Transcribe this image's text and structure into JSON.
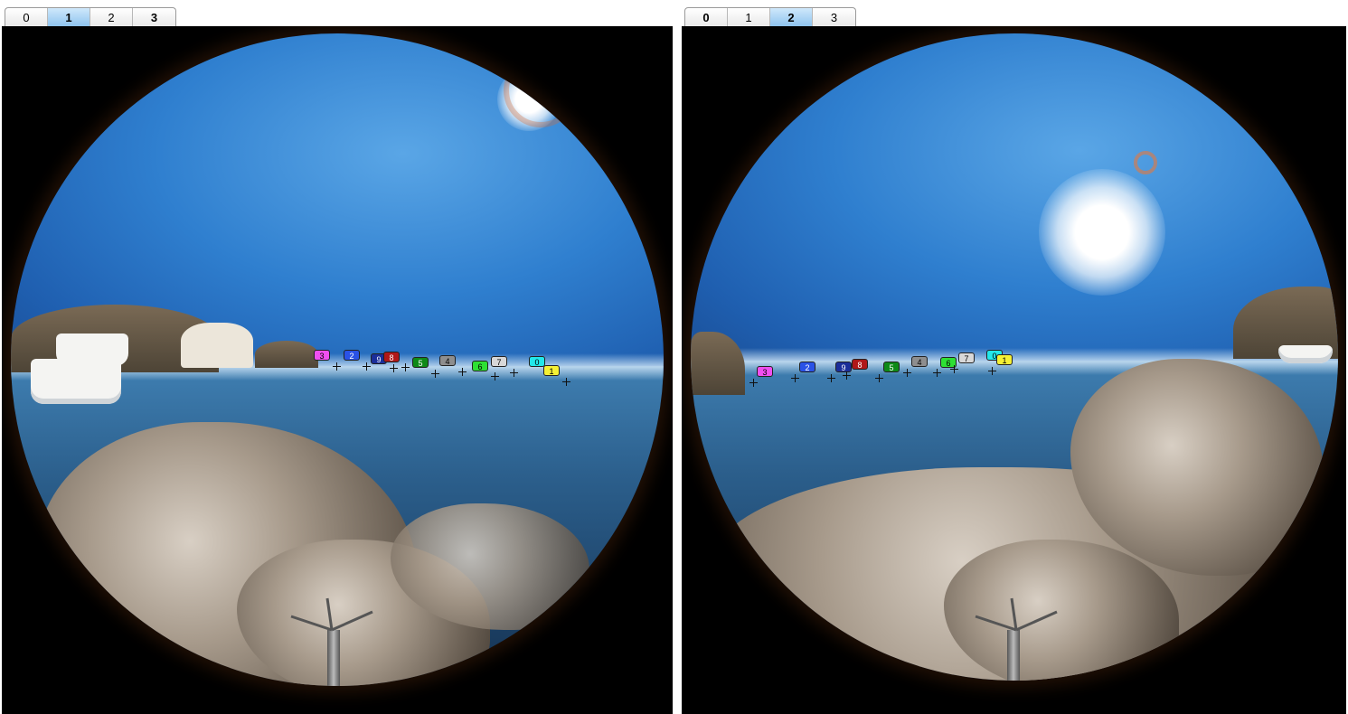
{
  "left_panel": {
    "tabs": [
      {
        "label": "0",
        "active": false,
        "bold": false
      },
      {
        "label": "1",
        "active": true,
        "bold": true
      },
      {
        "label": "2",
        "active": false,
        "bold": false
      },
      {
        "label": "3",
        "active": false,
        "bold": true
      }
    ],
    "markers": [
      {
        "label": "3",
        "color": "#f04ff0",
        "text_color": "#000000"
      },
      {
        "label": "2",
        "color": "#2a52e6",
        "text_color": "#ffffff"
      },
      {
        "label": "9",
        "color": "#1b2e9a",
        "text_color": "#ffffff"
      },
      {
        "label": "8",
        "color": "#b01818",
        "text_color": "#ffffff"
      },
      {
        "label": "5",
        "color": "#0e8a18",
        "text_color": "#ffffff"
      },
      {
        "label": "4",
        "color": "#8e8e8e",
        "text_color": "#000000"
      },
      {
        "label": "6",
        "color": "#2ee034",
        "text_color": "#000000"
      },
      {
        "label": "7",
        "color": "#d8d8d8",
        "text_color": "#000000"
      },
      {
        "label": "0",
        "color": "#22e8ea",
        "text_color": "#000000"
      },
      {
        "label": "1",
        "color": "#f5f035",
        "text_color": "#000000"
      }
    ]
  },
  "right_panel": {
    "tabs": [
      {
        "label": "0",
        "active": false,
        "bold": true
      },
      {
        "label": "1",
        "active": false,
        "bold": false
      },
      {
        "label": "2",
        "active": true,
        "bold": true
      },
      {
        "label": "3",
        "active": false,
        "bold": false
      }
    ],
    "markers": [
      {
        "label": "3",
        "color": "#f04ff0",
        "text_color": "#000000"
      },
      {
        "label": "2",
        "color": "#2a52e6",
        "text_color": "#ffffff"
      },
      {
        "label": "9",
        "color": "#1b2e9a",
        "text_color": "#ffffff"
      },
      {
        "label": "8",
        "color": "#b01818",
        "text_color": "#ffffff"
      },
      {
        "label": "5",
        "color": "#0e8a18",
        "text_color": "#ffffff"
      },
      {
        "label": "4",
        "color": "#8e8e8e",
        "text_color": "#000000"
      },
      {
        "label": "6",
        "color": "#2ee034",
        "text_color": "#000000"
      },
      {
        "label": "7",
        "color": "#d8d8d8",
        "text_color": "#000000"
      },
      {
        "label": "0",
        "color": "#22e8ea",
        "text_color": "#000000"
      },
      {
        "label": "1",
        "color": "#f5f035",
        "text_color": "#000000"
      }
    ]
  }
}
